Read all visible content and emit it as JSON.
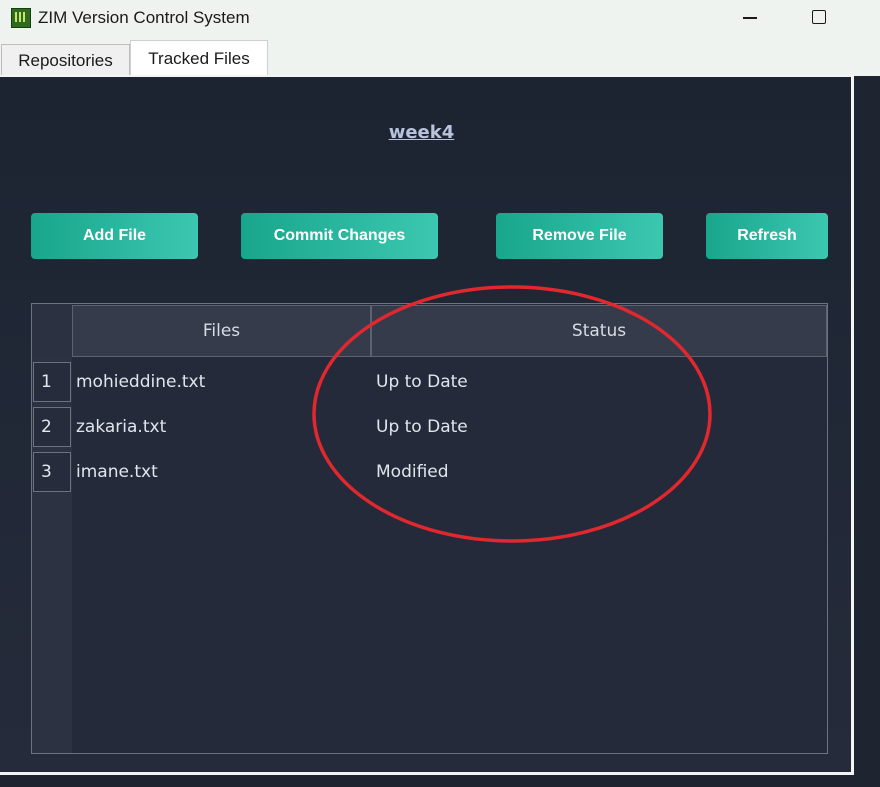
{
  "window": {
    "title": "ZIM Version Control System",
    "icon": "app-icon",
    "controls": [
      "minimize-icon",
      "maximize-icon"
    ]
  },
  "tabs": [
    {
      "label": "Repositories",
      "active": false
    },
    {
      "label": "Tracked Files",
      "active": true
    }
  ],
  "repository": {
    "name": "week4"
  },
  "actions": {
    "add": "Add File",
    "commit": "Commit Changes",
    "remove": "Remove File",
    "refresh": "Refresh"
  },
  "table": {
    "columns": [
      "Files",
      "Status"
    ],
    "rows": [
      {
        "num": "1",
        "file": "mohieddine.txt",
        "status": "Up to Date"
      },
      {
        "num": "2",
        "file": "zakaria.txt",
        "status": "Up to Date"
      },
      {
        "num": "3",
        "file": "imane.txt",
        "status": "Modified"
      }
    ]
  },
  "colors": {
    "accent": "#1fb59a",
    "annotation": "#e0282e",
    "background": "#1f2530"
  }
}
